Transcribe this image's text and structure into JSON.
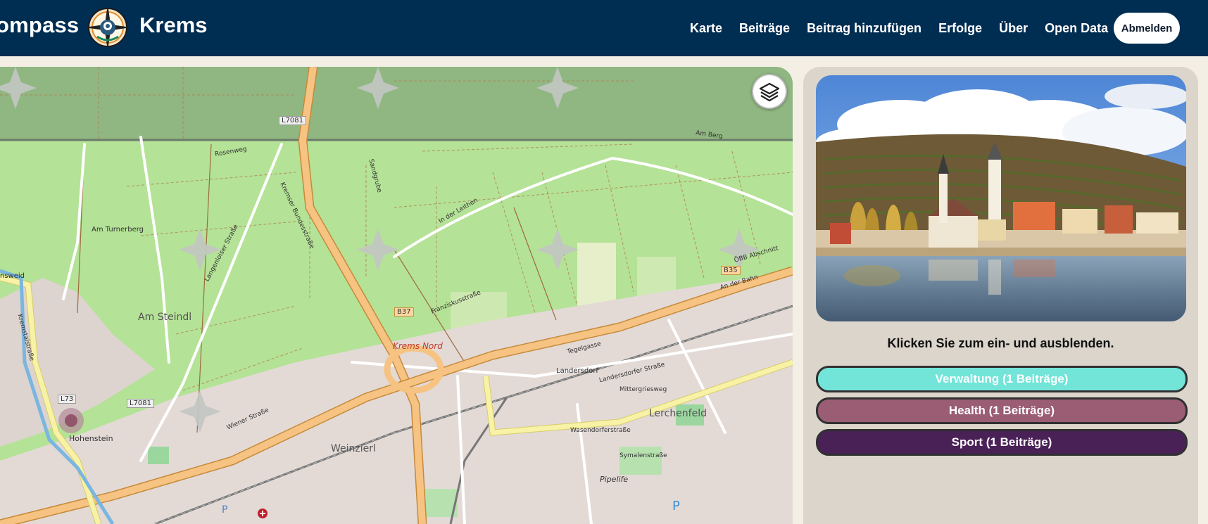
{
  "header": {
    "brand_left": "ompass",
    "brand_right": "Krems",
    "nav": [
      "Karte",
      "Beiträge",
      "Beitrag hinzufügen",
      "Erfolge",
      "Über",
      "Open Data"
    ],
    "logout_label": "Abmelden",
    "logo_icon": "compass-logo-icon",
    "background": "#002d52"
  },
  "map": {
    "layers_icon": "layers-icon",
    "labels": {
      "am_steindl": "Am Steindl",
      "lerchenfeld": "Lerchenfeld",
      "weinzierl": "Weinzierl",
      "hohenstein": "Hohenstein",
      "krems_nord": "Krems Nord",
      "am_turnerberg": "Am Turnerberg",
      "landersdorf": "Landersdorf",
      "kremser_bundesstrasse": "Kremser Bundesstraße",
      "in_der_leithen": "In der Leithen",
      "landersdorfer_strasse": "Landersdorfer Straße",
      "wiener_strasse": "Wiener Straße",
      "langenloiser_strasse": "Langenloiser Straße",
      "kremstalstrasse": "Kremstalstraße",
      "franzisksusstrasse": "Franziskusstraße",
      "mittergriesweg": "Mittergriesweg",
      "wasendorferstrasse": "Wasendorferstraße",
      "symalenstrasse": "Symalenstraße",
      "tegelgasse": "Tegelgasse",
      "rosenweg": "Rosenweg",
      "am_berg": "Am Berg",
      "pipelife": "Pipelife",
      "oebb": "ÖBB Abschnitt",
      "inswein": "nsweid",
      "an_der_bahn": "An der Bahn",
      "sandgrube": "Sandgrube"
    },
    "shields": {
      "l7081_top": "L7081",
      "l7081_bottom": "L7081",
      "b37": "B37",
      "b35": "B35",
      "l73": "L73"
    }
  },
  "panel": {
    "hint": "Klicken Sie zum ein- und ausblenden.",
    "categories": [
      {
        "label": "Verwaltung (1 Beiträge)",
        "color": "#72e4d8",
        "text_color": "#ffffff"
      },
      {
        "label": "Health (1 Beiträge)",
        "color": "#9a5d73",
        "text_color": "#ffffff"
      },
      {
        "label": "Sport (1 Beiträge)",
        "color": "#4a2157",
        "text_color": "#ffffff"
      }
    ]
  }
}
